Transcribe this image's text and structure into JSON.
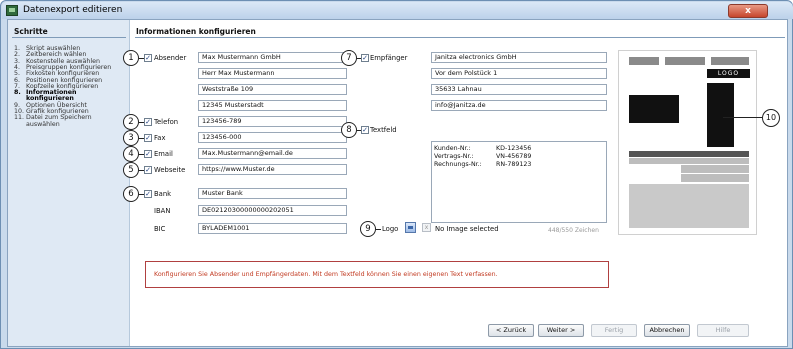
{
  "window": {
    "title": "Datenexport editieren",
    "close_label": "x"
  },
  "sidebar": {
    "title": "Schritte",
    "steps": [
      {
        "n": "1.",
        "label": "Skript auswählen"
      },
      {
        "n": "2.",
        "label": "Zeitbereich wählen"
      },
      {
        "n": "3.",
        "label": "Kostenstelle auswählen"
      },
      {
        "n": "4.",
        "label": "Preisgruppen konfigurieren"
      },
      {
        "n": "5.",
        "label": "Fixkosten konfigurieren"
      },
      {
        "n": "6.",
        "label": "Positionen konfigurieren"
      },
      {
        "n": "7.",
        "label": "Kopfzeile konfigurieren"
      },
      {
        "n": "8.",
        "label": "Informationen"
      },
      {
        "n": "",
        "label": "konfigurieren"
      },
      {
        "n": "9.",
        "label": "Optionen Übersicht"
      },
      {
        "n": "10.",
        "label": "Grafik konfigurieren"
      },
      {
        "n": "11.",
        "label": "Datei zum Speichern"
      },
      {
        "n": "",
        "label": "auswählen"
      }
    ]
  },
  "main": {
    "title": "Informationen konfigurieren",
    "sender": {
      "label": "Absender",
      "checked": true,
      "lines": [
        "Max Mustermann GmbH",
        "Herr Max Mustermann",
        "Weststraße 109",
        "12345 Musterstadt"
      ]
    },
    "recipient": {
      "label": "Empfänger",
      "checked": true,
      "lines": [
        "Janitza electronics GmbH",
        "Vor dem Polstück 1",
        "35633 Lahnau",
        "info@Janitza.de"
      ]
    },
    "phone": {
      "label": "Telefon",
      "value": "123456-789",
      "checked": true
    },
    "fax": {
      "label": "Fax",
      "value": "123456-000",
      "checked": true
    },
    "email": {
      "label": "Email",
      "value": "Max.Mustermann@email.de",
      "checked": true
    },
    "website": {
      "label": "Webseite",
      "value": "https://www.Muster.de",
      "checked": true
    },
    "bank": {
      "label": "Bank",
      "value": "Muster Bank",
      "checked": true
    },
    "iban": {
      "label": "IBAN",
      "value": "DE02120300000000202051"
    },
    "bic": {
      "label": "BIC",
      "value": "BYLADEM1001"
    },
    "freetext": {
      "label": "Textfeld",
      "checked": true,
      "rows": [
        {
          "k": "Kunden-Nr.:",
          "v": "KD-123456"
        },
        {
          "k": "Vertrags-Nr.:",
          "v": "VN-456789"
        },
        {
          "k": "Rechnungs-Nr.:",
          "v": "RN-789123"
        }
      ],
      "char_count": "448/550 Zeichen"
    },
    "logo": {
      "label": "Logo",
      "browse_icon": "folder-icon",
      "clear_label": "x",
      "status": "No Image selected"
    },
    "info": "Konfigurieren Sie Absender und Empfängerdaten. Mit dem Textfeld können Sie einen eigenen Text verfassen.",
    "preview_logo_text": "LOGO"
  },
  "callouts": [
    "1",
    "2",
    "3",
    "4",
    "5",
    "6",
    "7",
    "8",
    "9",
    "10"
  ],
  "buttons": {
    "back": "< Zurück",
    "next": "Weiter >",
    "finish": "Fertig",
    "cancel": "Abbrechen",
    "help": "Hilfe"
  }
}
